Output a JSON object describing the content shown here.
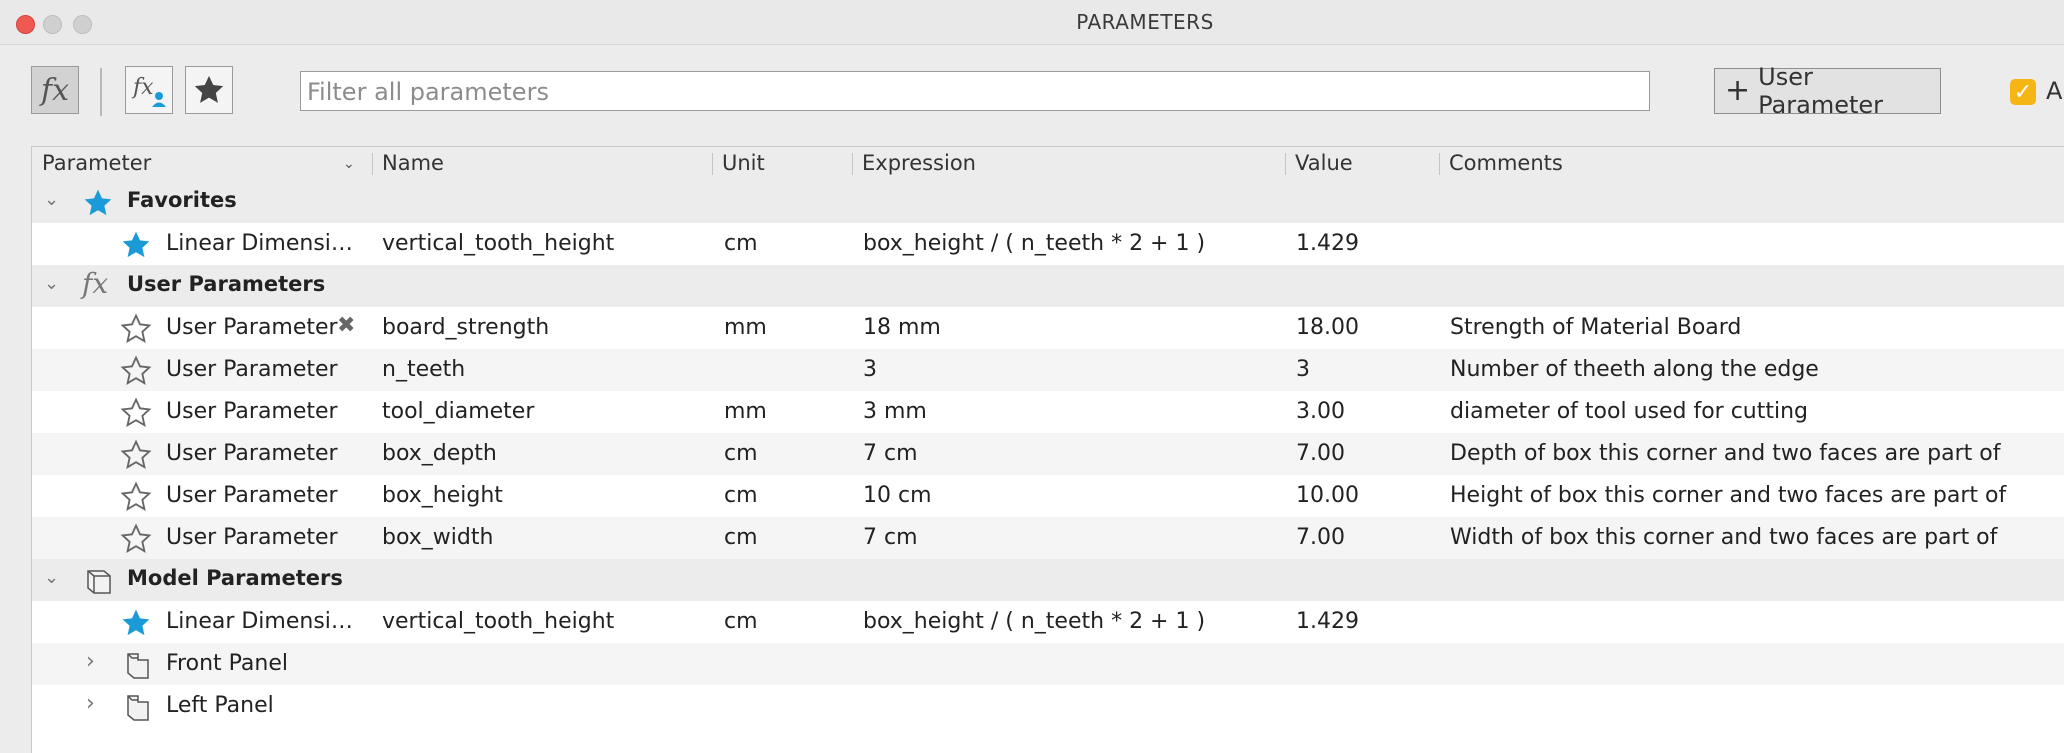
{
  "window": {
    "title": "PARAMETERS"
  },
  "toolbar": {
    "filter_placeholder": "Filter all parameters",
    "user_param_button": "User Parameter",
    "checkbox_label": "A"
  },
  "table": {
    "headers": {
      "parameter": "Parameter",
      "name": "Name",
      "unit": "Unit",
      "expression": "Expression",
      "value": "Value",
      "comments": "Comments"
    },
    "groups": {
      "favorites": "Favorites",
      "user": "User Parameters",
      "model": "Model Parameters"
    },
    "favorite_rows": [
      {
        "parameter": "Linear Dimensi…",
        "name": "vertical_tooth_height",
        "unit": "cm",
        "expression": "box_height / ( n_teeth * 2 + 1 )",
        "value": "1.429",
        "comments": ""
      }
    ],
    "user_rows": [
      {
        "parameter": "User Parameter",
        "name": "board_strength",
        "unit": "mm",
        "expression": "18 mm",
        "value": "18.00",
        "comments": "Strength of Material Board"
      },
      {
        "parameter": "User Parameter",
        "name": "n_teeth",
        "unit": "",
        "expression": "3",
        "value": "3",
        "comments": "Number of theeth along the edge"
      },
      {
        "parameter": "User Parameter",
        "name": "tool_diameter",
        "unit": "mm",
        "expression": "3 mm",
        "value": "3.00",
        "comments": "diameter of tool used for cutting"
      },
      {
        "parameter": "User Parameter",
        "name": "box_depth",
        "unit": "cm",
        "expression": "7 cm",
        "value": "7.00",
        "comments": "Depth of box this corner and two faces are part of"
      },
      {
        "parameter": "User Parameter",
        "name": "box_height",
        "unit": "cm",
        "expression": "10 cm",
        "value": "10.00",
        "comments": "Height of box this corner and two faces are part of"
      },
      {
        "parameter": "User Parameter",
        "name": "box_width",
        "unit": "cm",
        "expression": "7 cm",
        "value": "7.00",
        "comments": "Width of box this corner and two faces are part of"
      }
    ],
    "model_rows": [
      {
        "parameter": "Linear Dimensi…",
        "name": "vertical_tooth_height",
        "unit": "cm",
        "expression": "box_height / ( n_teeth * 2 + 1 )",
        "value": "1.429",
        "comments": ""
      }
    ],
    "components": [
      {
        "label": "Front Panel"
      },
      {
        "label": "Left Panel"
      }
    ]
  },
  "colors": {
    "accent_star": "#1a9bd7",
    "checkbox": "#f5b614",
    "close": "#ee5a52"
  },
  "icons": [
    "fx-icon",
    "fx-user-icon",
    "star-icon",
    "plus-icon",
    "check-icon",
    "cube-icon",
    "component-icon",
    "chevron-down-icon",
    "chevron-right-icon",
    "star-outline-icon",
    "delete-icon"
  ]
}
